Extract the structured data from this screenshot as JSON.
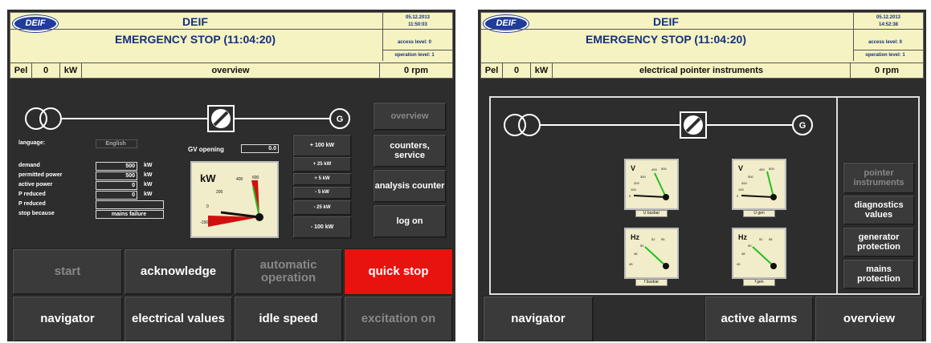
{
  "colors": {
    "header_bg": "#f6f3c2",
    "title_blue": "#14307e",
    "panel_bg": "#2d2d2d",
    "quick_stop": "#e8120e",
    "needle_green": "#20c020",
    "needle_red": "#d01010"
  },
  "left": {
    "logo": "DEIF",
    "brand": "DEIF",
    "status": "EMERGENCY STOP (11:04:20)",
    "date": "05.12.2013",
    "time": "11:50:03",
    "access_level": "access level: 0",
    "operation_level": "operation level: 1",
    "pel_label": "Pel",
    "pel_value": "0",
    "pel_unit": "kW",
    "page_title": "overview",
    "rpm": "0 rpm",
    "fields": {
      "language_label": "language:",
      "language_value": "English",
      "gv_label": "GV opening",
      "gv_value": "0.0",
      "demand_label": "demand",
      "demand_value": "500",
      "demand_unit": "kW",
      "permitted_label": "permitted power",
      "permitted_value": "500",
      "permitted_unit": "kW",
      "active_label": "active power",
      "active_value": "0",
      "active_unit": "kW",
      "preduced1_label": "P reduced",
      "preduced1_value": "0",
      "preduced1_unit": "kW",
      "preduced2_label": "P reduced",
      "preduced2_value": "",
      "stop_label": "stop because",
      "stop_value": "mains failure"
    },
    "kw_gauge": {
      "title": "kW",
      "ticks": [
        "600",
        "400",
        "200",
        "0",
        "-150"
      ],
      "value": 0
    },
    "setpoint_buttons": [
      "+ 100 kW",
      "+ 25 kW",
      "+ 5 kW",
      "- 5 kW",
      "- 25 kW",
      "- 100 kW"
    ],
    "side_buttons": [
      "overview",
      "counters, service",
      "analysis counter",
      "log on"
    ],
    "bottom_row1": [
      "start",
      "acknowledge",
      "automatic operation",
      "quick stop"
    ],
    "bottom_row2": [
      "navigator",
      "electrical values",
      "idle speed",
      "excitation on"
    ]
  },
  "right": {
    "logo": "DEIF",
    "brand": "DEIF",
    "status": "EMERGENCY STOP (11:04:20)",
    "date": "05.12.2013",
    "time": "14:52:38",
    "access_level": "access level: 0",
    "operation_level": "operation level: 1",
    "pel_label": "Pel",
    "pel_value": "0",
    "pel_unit": "kW",
    "page_title": "electrical pointer instruments",
    "rpm": "0 rpm",
    "gauges": [
      {
        "unit": "V",
        "label": "U busbar",
        "ticks": [
          "500",
          "400",
          "300",
          "200",
          "100",
          "0"
        ]
      },
      {
        "unit": "V",
        "label": "U gen",
        "ticks": [
          "500",
          "400",
          "300",
          "200",
          "100",
          "0"
        ]
      },
      {
        "unit": "Hz",
        "label": "f busbar",
        "ticks": [
          "55",
          "52",
          "50",
          "48",
          "45"
        ]
      },
      {
        "unit": "Hz",
        "label": "f gen",
        "ticks": [
          "55",
          "52",
          "50",
          "48",
          "45"
        ]
      }
    ],
    "side_buttons": [
      "pointer instruments",
      "diagnostics values",
      "generator protection",
      "mains protection"
    ],
    "bottom": [
      "navigator",
      "",
      "active alarms",
      "overview"
    ]
  }
}
